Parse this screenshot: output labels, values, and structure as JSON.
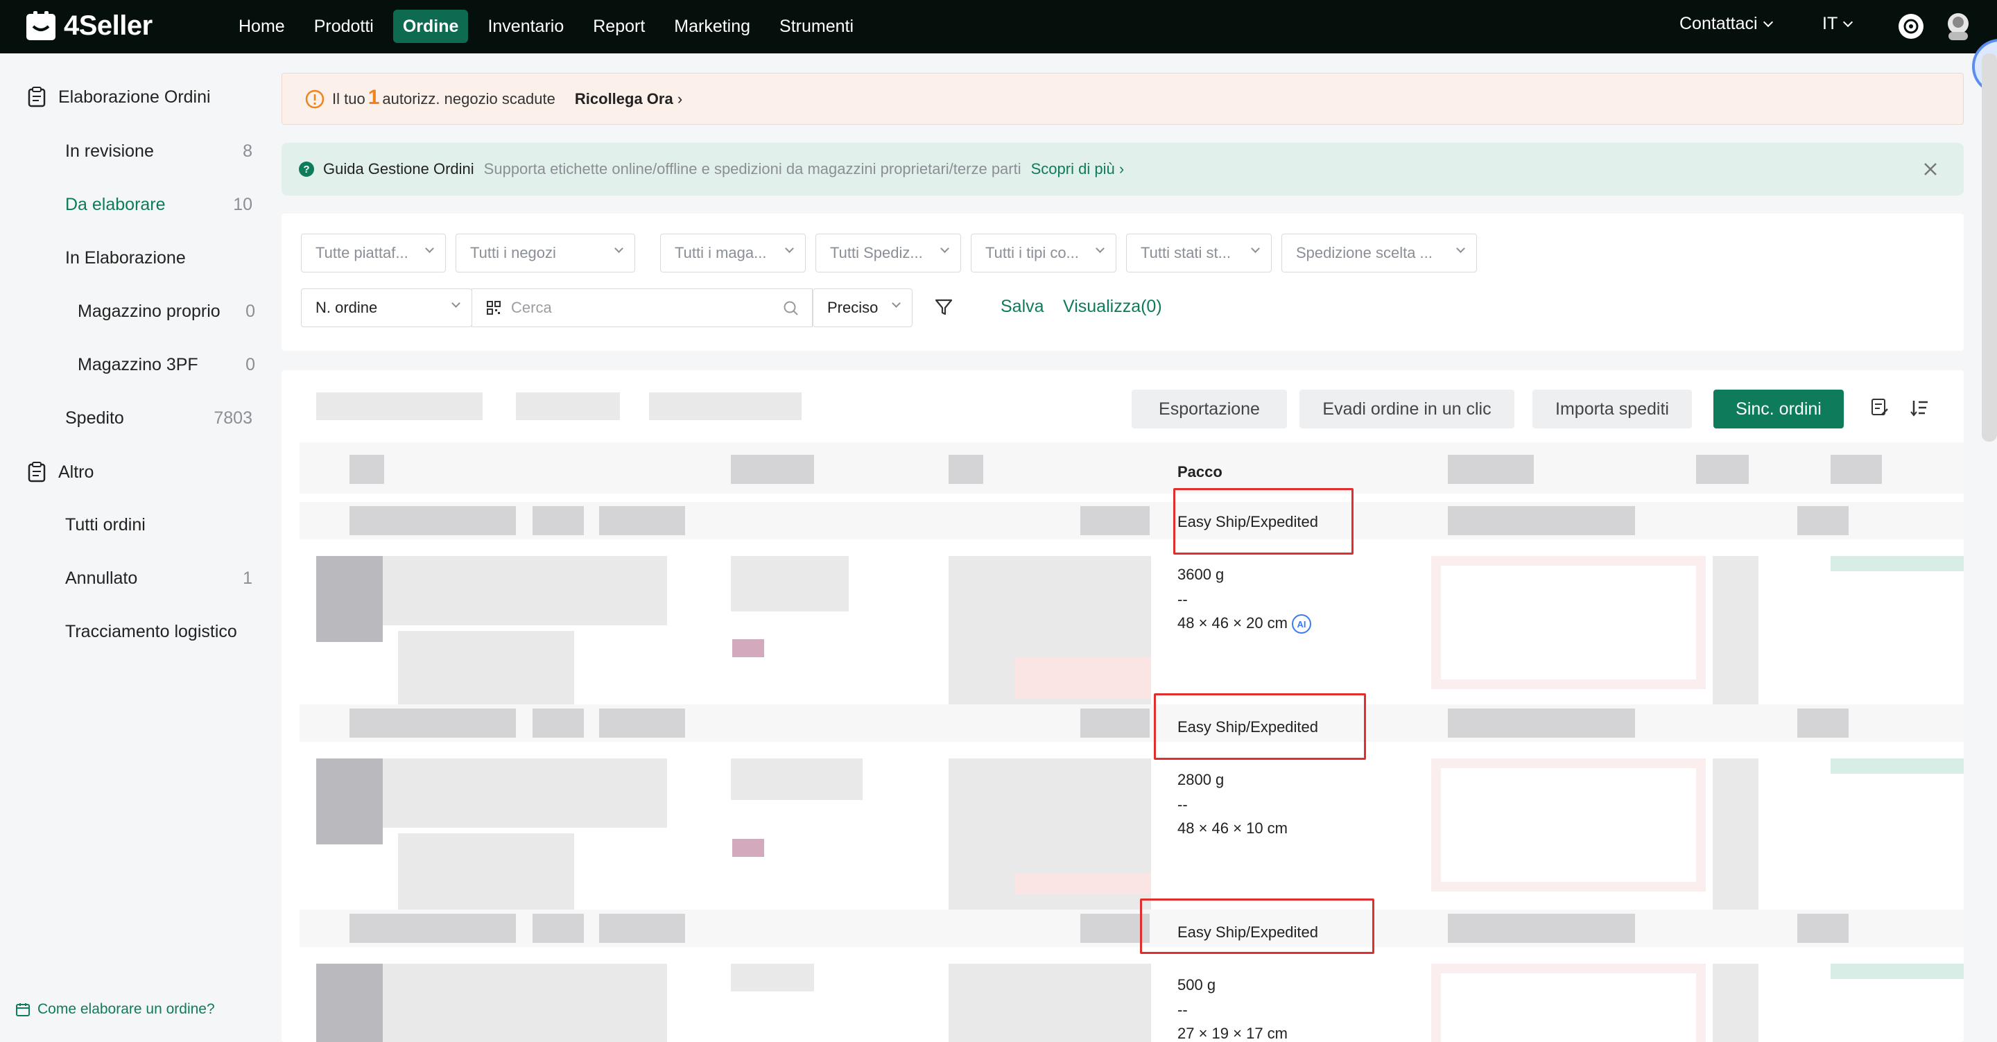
{
  "app": {
    "logo_text": "4Seller",
    "nav": [
      "Home",
      "Prodotti",
      "Ordine",
      "Inventario",
      "Report",
      "Marketing",
      "Strumenti"
    ],
    "active_nav": "Ordine",
    "contact": "Contattaci",
    "language": "IT"
  },
  "sidebar": {
    "group1": "Elaborazione Ordini",
    "items": [
      {
        "label": "In revisione",
        "count": "8"
      },
      {
        "label": "Da elaborare",
        "count": "10"
      },
      {
        "label": "In Elaborazione",
        "count": ""
      },
      {
        "label": "Magazzino proprio",
        "count": "0"
      },
      {
        "label": "Magazzino 3PF",
        "count": "0"
      },
      {
        "label": "Spedito",
        "count": "7803"
      }
    ],
    "group2": "Altro",
    "items2": [
      {
        "label": "Tutti ordini",
        "count": ""
      },
      {
        "label": "Annullato",
        "count": "1"
      },
      {
        "label": "Tracciamento logistico",
        "count": ""
      }
    ],
    "help": "Come elaborare un ordine?"
  },
  "alert": {
    "prefix": "Il tuo",
    "count": "1",
    "text": "autorizz. negozio scadute",
    "link": "Ricollega Ora"
  },
  "guide": {
    "title": "Guida Gestione Ordini",
    "desc": "Supporta etichette online/offline e spedizioni da magazzini proprietari/terze parti",
    "link": "Scopri di più"
  },
  "filters": {
    "row1": [
      "Tutte piattaf...",
      "Tutti i negozi",
      "Tutti i maga...",
      "Tutti Spediz...",
      "Tutti i tipi co...",
      "Tutti stati st...",
      "Spedizione scelta ..."
    ],
    "search_type": "N. ordine",
    "search_placeholder": "Cerca",
    "match": "Preciso",
    "save": "Salva",
    "view": "Visualizza(0)"
  },
  "toolbar": {
    "export": "Esportazione",
    "one_click": "Evadi ordine in un clic",
    "import": "Importa spediti",
    "sync": "Sinc. ordini"
  },
  "orders": {
    "package_header": "Pacco",
    "rows": [
      {
        "shipping": "Easy Ship/Expedited",
        "weight": "3600 g",
        "sep": "--",
        "dims": "48 × 46 × 20 cm",
        "ai": "AI"
      },
      {
        "shipping": "Easy Ship/Expedited",
        "weight": "2800 g",
        "sep": "--",
        "dims": "48 × 46 × 10 cm",
        "ai": ""
      },
      {
        "shipping": "Easy Ship/Expedited",
        "weight": "500 g",
        "sep": "--",
        "dims": "27 × 19 × 17 cm",
        "ai": ""
      }
    ]
  }
}
